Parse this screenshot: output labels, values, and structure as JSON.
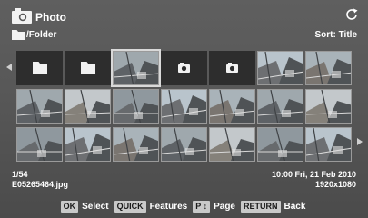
{
  "header": {
    "title": "Photo",
    "folder_path": "/Folder",
    "sort_label": "Sort: Title"
  },
  "grid": {
    "rows": [
      [
        "folder",
        "folder",
        "photo-selected",
        "photo-placeholder",
        "photo-placeholder",
        "photo",
        "photo"
      ],
      [
        "photo",
        "photo",
        "photo",
        "photo",
        "photo",
        "photo",
        "photo"
      ],
      [
        "photo",
        "photo",
        "photo",
        "photo",
        "photo",
        "photo",
        "photo"
      ]
    ]
  },
  "info": {
    "position": "1/54",
    "filename": "E05265464.jpg",
    "datetime": "10:00 Fri, 21 Feb 2010",
    "resolution": "1920x1080"
  },
  "help": {
    "ok_key": "OK",
    "ok_text": "Select",
    "quick_key": "QUICK",
    "quick_text": "Features",
    "page_key": "P ↕",
    "page_text": "Page",
    "return_key": "RETURN",
    "return_text": "Back"
  },
  "icons": {
    "app": "camera-icon",
    "refresh": "refresh-icon",
    "folder": "folder-icon",
    "left": "chevron-left-icon",
    "right": "chevron-right-icon"
  },
  "colors": {
    "background_top": "#5f5f5f",
    "background_bottom": "#4b4b4b",
    "thumbnail_placeholder": "#2d2d2d",
    "key_badge": "#c9c9c9",
    "text": "#ffffff"
  }
}
